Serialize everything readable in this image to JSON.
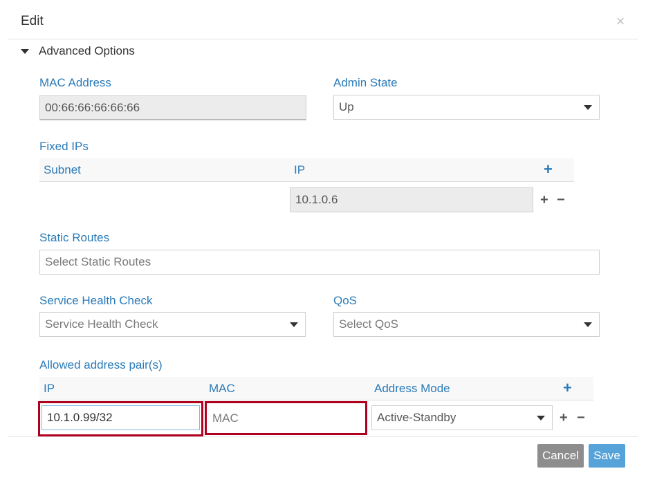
{
  "dialog": {
    "title": "Edit",
    "close_icon": "×"
  },
  "advanced": {
    "label": "Advanced Options"
  },
  "mac": {
    "label": "MAC Address",
    "value": "00:66:66:66:66:66"
  },
  "admin_state": {
    "label": "Admin State",
    "value": "Up"
  },
  "fixed_ips": {
    "label": "Fixed IPs",
    "columns": [
      "Subnet",
      "IP"
    ],
    "row": {
      "ip": "10.1.0.6"
    }
  },
  "static_routes": {
    "label": "Static Routes",
    "placeholder": "Select Static Routes"
  },
  "health_check": {
    "label": "Service Health Check",
    "placeholder": "Service Health Check"
  },
  "qos": {
    "label": "QoS",
    "placeholder": "Select QoS"
  },
  "aap": {
    "label": "Allowed address pair(s)",
    "columns": [
      "IP",
      "MAC",
      "Address Mode"
    ],
    "row": {
      "ip": "10.1.0.99/32",
      "mac_placeholder": "MAC",
      "mode": "Active-Standby"
    }
  },
  "footer": {
    "cancel": "Cancel",
    "save": "Save"
  },
  "symbols": {
    "plus": "+",
    "minus": "−"
  },
  "colors": {
    "label_blue": "#2a7ab8",
    "highlight_red": "#b00020",
    "save_blue": "#56a3d9",
    "cancel_gray": "#8d8d8d"
  }
}
